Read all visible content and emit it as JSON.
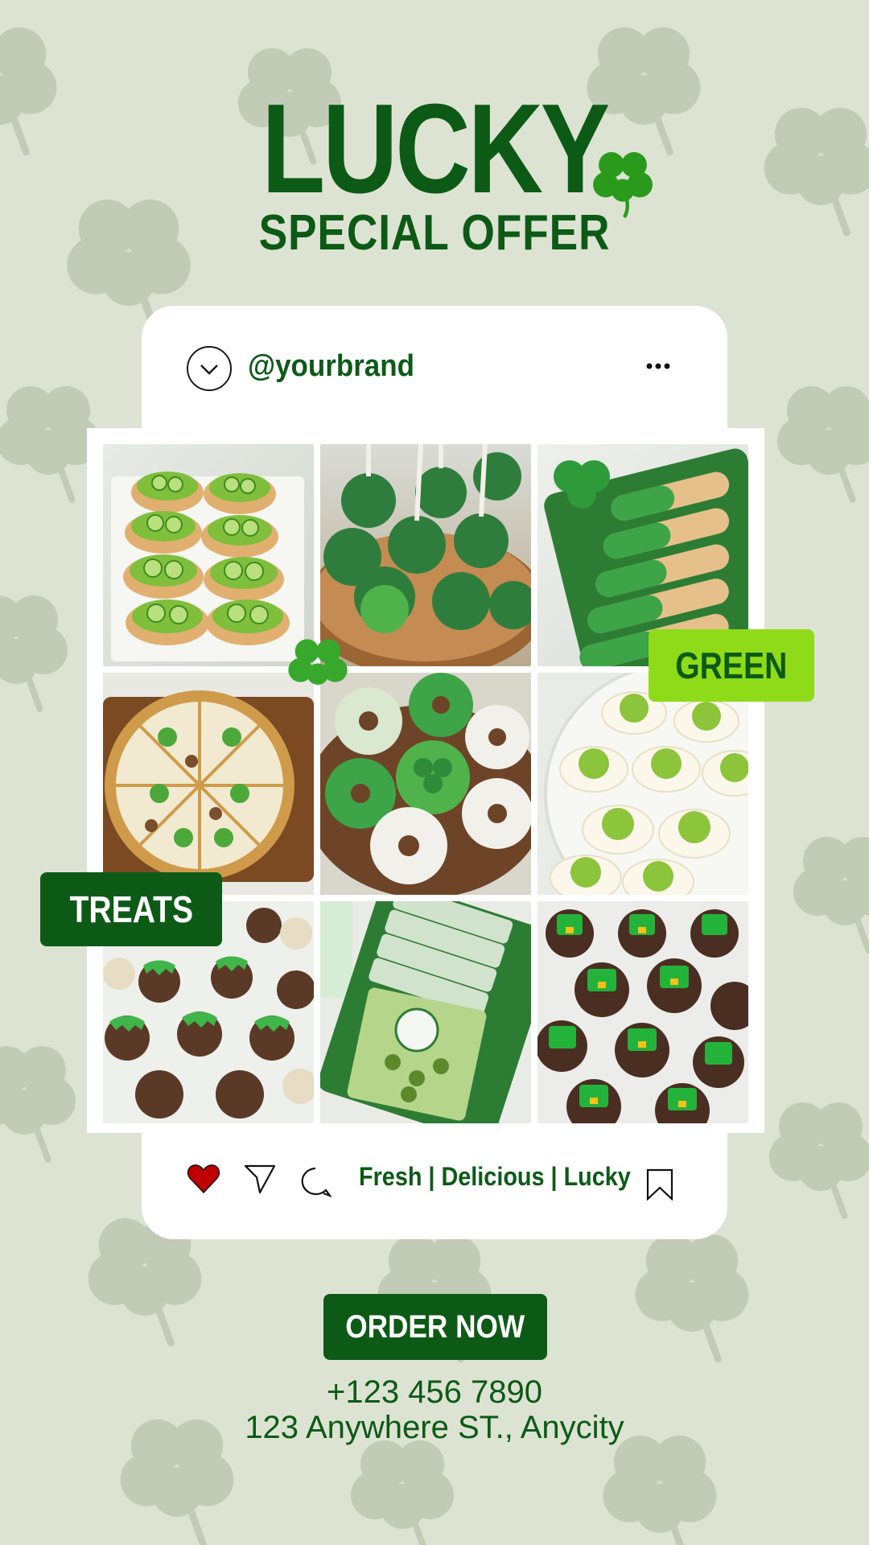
{
  "header": {
    "title": "LUCKY",
    "subtitle": "SPECIAL OFFER"
  },
  "post": {
    "handle": "@yourbrand",
    "tagline": "Fresh | Delicious | Lucky",
    "tiles": [
      {
        "name": "cucumber-toasts"
      },
      {
        "name": "cake-pops"
      },
      {
        "name": "dipped-cookies"
      },
      {
        "name": "shamrock-pizza"
      },
      {
        "name": "green-donuts"
      },
      {
        "name": "deviled-eggs"
      },
      {
        "name": "truffle-skewers"
      },
      {
        "name": "snack-bags"
      },
      {
        "name": "leprechaun-hat-cookies"
      }
    ]
  },
  "badges": {
    "green": "GREEN",
    "treats": "TREATS"
  },
  "cta": {
    "order_label": "ORDER NOW"
  },
  "contact": {
    "phone": "+123 456 7890",
    "address": "123 Anywhere ST., Anycity"
  },
  "colors": {
    "brand": "#0c5a16",
    "accent": "#8fdb1a",
    "background": "#dde3d2",
    "heart": "#c00000"
  }
}
